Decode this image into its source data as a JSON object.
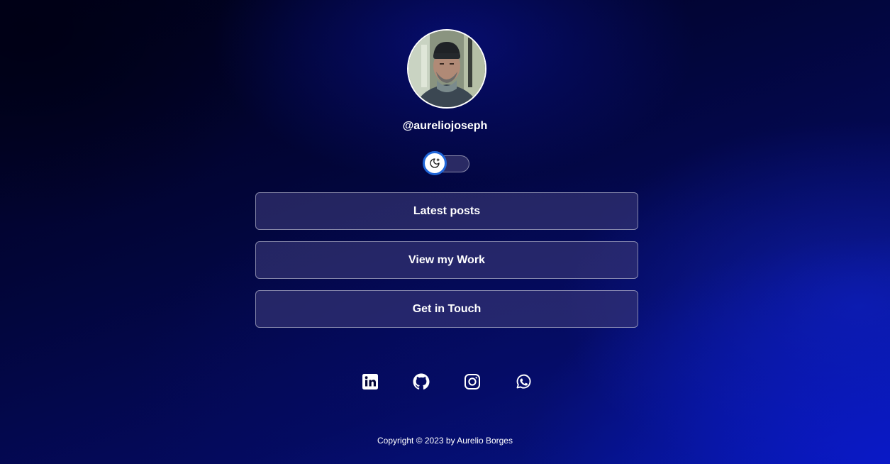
{
  "profile": {
    "username": "@aureliojoseph"
  },
  "theme_toggle": {
    "state": "dark",
    "icon": "moon-icon"
  },
  "links": [
    {
      "label": "Latest posts"
    },
    {
      "label": "View my Work"
    },
    {
      "label": "Get in Touch"
    }
  ],
  "social": [
    {
      "icon": "linkedin-icon"
    },
    {
      "icon": "github-icon"
    },
    {
      "icon": "instagram-icon"
    },
    {
      "icon": "whatsapp-icon"
    }
  ],
  "footer": {
    "copyright": "Copyright © 2023 by Aurelio Borges"
  },
  "colors": {
    "background_dark": "#020537",
    "background_accent": "#0a19c8",
    "button_fill": "#3a3878",
    "toggle_ring": "#1f66d9"
  }
}
